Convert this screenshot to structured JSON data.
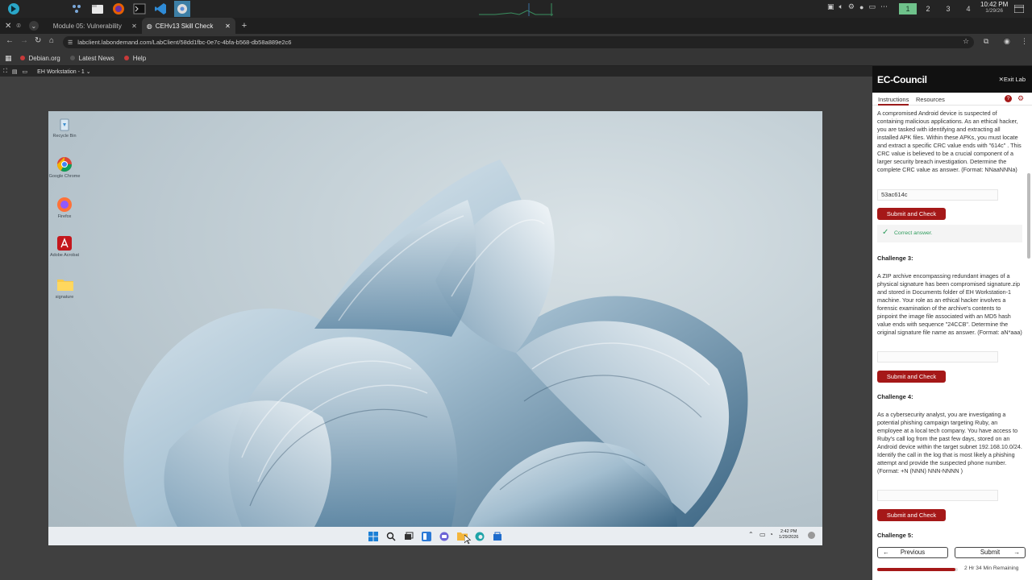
{
  "os_panel": {
    "clock_time": "10:42 PM",
    "clock_date": "1/29/26",
    "workspaces": [
      "1",
      "2",
      "3",
      "4"
    ],
    "active_workspace": "1"
  },
  "browser": {
    "tabs": [
      {
        "title": "Module 05: Vulnerability",
        "active": false
      },
      {
        "title": "CEHv13 Skill Check",
        "active": true
      }
    ],
    "url": "labclient.labondemand.com/LabClient/58dd1fbc-0e7c-4bfa-b568-db58a889e2c6",
    "bookmarks": [
      "Debian.org",
      "Latest News",
      "Help"
    ]
  },
  "lab_toolbar": {
    "machine_selector": "EH Workstation - 1"
  },
  "vm": {
    "desktop_icons": [
      {
        "label": "Recycle Bin",
        "icon": "recycle-bin-icon"
      },
      {
        "label": "Google Chrome",
        "icon": "chrome-icon"
      },
      {
        "label": "Firefox",
        "icon": "firefox-icon"
      },
      {
        "label": "Adobe Acrobat",
        "icon": "acrobat-icon"
      },
      {
        "label": "signature",
        "icon": "folder-icon"
      }
    ],
    "taskbar_time": "2:42 PM",
    "taskbar_date": "1/29/2026"
  },
  "panel": {
    "brand": "EC-Council",
    "exit_label": "Exit Lab",
    "tabs": [
      "Instructions",
      "Resources"
    ],
    "challenge2_text": "A compromised Android device is suspected of containing malicious applications. As an ethical hacker, you are tasked with identifying and extracting all installed APK files. Within these APKs, you must locate and extract a specific CRC value ends with \"614c\" . This CRC value is believed to be a crucial component of a larger security breach investigation. Determine the complete CRC value as answer. (Format: NNaaNNNa)",
    "challenge2_answer": "53ac614c",
    "submit_label": "Submit and Check",
    "correct_label": "Correct answer.",
    "challenge3_heading": "Challenge 3:",
    "challenge3_text": "A ZIP archive encompassing redundant images of a physical signature has been compromised signature.zip and stored in Documents folder of EH Workstation-1 machine. Your role as an ethical hacker involves a forensic examination of the archive's contents to pinpoint the image file associated with an MD5 hash value ends with sequence \"24CCB\". Determine the original signature file name as answer. (Format: aN*aaa)",
    "challenge3_answer": "",
    "challenge4_heading": "Challenge 4:",
    "challenge4_text": "As a cybersecurity analyst, you are investigating a potential phishing campaign targeting Ruby, an employee at a local tech company. You have access to Ruby's call log from the past few days, stored on an Android device within the target subnet 192.168.10.0/24. Identify the call in the log that is most likely a phishing attempt and provide the suspected phone number. (Format: +N (NNN) NNN-NNNN )",
    "challenge4_answer": "",
    "challenge5_heading": "Challenge 5:",
    "previous_label": "Previous",
    "next_label": "Submit",
    "time_remaining": "2 Hr 34 Min Remaining",
    "progress_fraction": 0.97,
    "accent_color": "#a51818"
  }
}
